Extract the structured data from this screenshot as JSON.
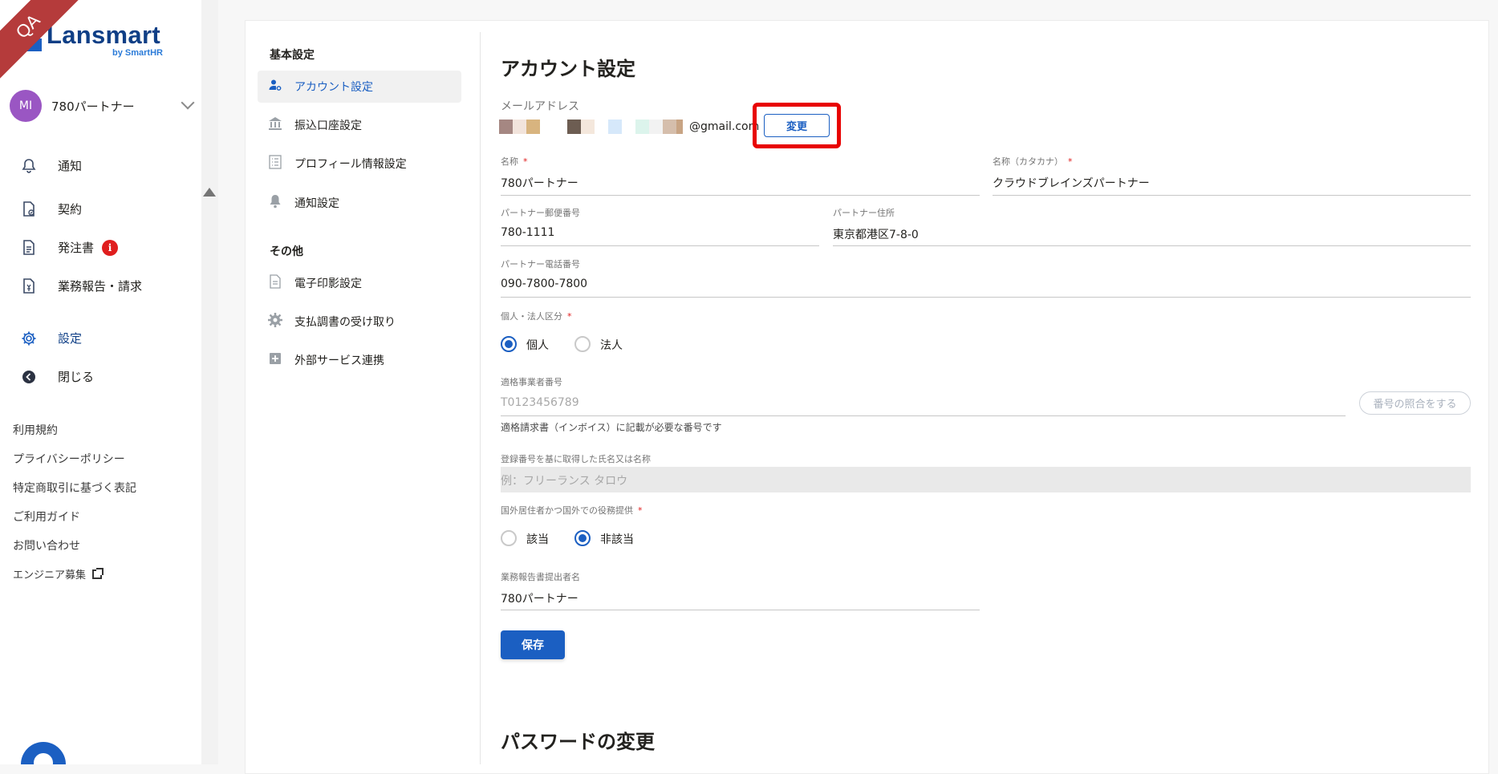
{
  "ribbon": "QA",
  "logo": {
    "text": "Lansmart",
    "sub": "by SmartHR"
  },
  "user": {
    "initials": "MI",
    "name": "780パートナー"
  },
  "nav": {
    "notice": "通知",
    "contract": "契約",
    "order": "発注書",
    "order_badge": "i",
    "report": "業務報告・請求",
    "settings": "設定",
    "close": "閉じる"
  },
  "footer": {
    "terms": "利用規約",
    "privacy": "プライバシーポリシー",
    "commerce": "特定商取引に基づく表記",
    "guide": "ご利用ガイド",
    "contact": "お問い合わせ",
    "engineer": "エンジニア募集"
  },
  "subnav": {
    "head_basic": "基本設定",
    "account": "アカウント設定",
    "bank": "振込口座設定",
    "profile": "プロフィール情報設定",
    "notify": "通知設定",
    "head_other": "その他",
    "seal": "電子印影設定",
    "payment": "支払調書の受け取り",
    "external": "外部サービス連携"
  },
  "form": {
    "title": "アカウント設定",
    "email_label": "メールアドレス",
    "email_tail": "@gmail.com",
    "change_label": "変更",
    "name_label": "名称",
    "name_value": "780パートナー",
    "kana_label": "名称（カタカナ）",
    "kana_value": "クラウドブレインズパートナー",
    "zip_label": "パートナー郵便番号",
    "zip_value": "780-1111",
    "addr_label": "パートナー住所",
    "addr_value": "東京都港区7-8-0",
    "tel_label": "パートナー電話番号",
    "tel_value": "090-7800-7800",
    "entity_label": "個人・法人区分",
    "entity_individual": "個人",
    "entity_corp": "法人",
    "entity_selected": "個人",
    "invoice_label": "適格事業者番号",
    "invoice_placeholder": "T0123456789",
    "check_btn": "番号の照合をする",
    "invoice_hint": "適格請求書（インボイス）に記載が必要な番号です",
    "regname_label": "登録番号を基に取得した氏名又は名称",
    "regname_placeholder": "例：フリーランス タロウ",
    "foreign_label": "国外居住者かつ国外での役務提供",
    "foreign_yes": "該当",
    "foreign_no": "非該当",
    "foreign_selected": "非該当",
    "reporter_label": "業務報告書提出者名",
    "reporter_value": "780パートナー",
    "save": "保存",
    "password_title": "パスワードの変更"
  },
  "colors": {
    "primary": "#1b5fc2",
    "required": "#e01e1e",
    "highlight": "#e80000",
    "avatar": "#9a56c3"
  }
}
